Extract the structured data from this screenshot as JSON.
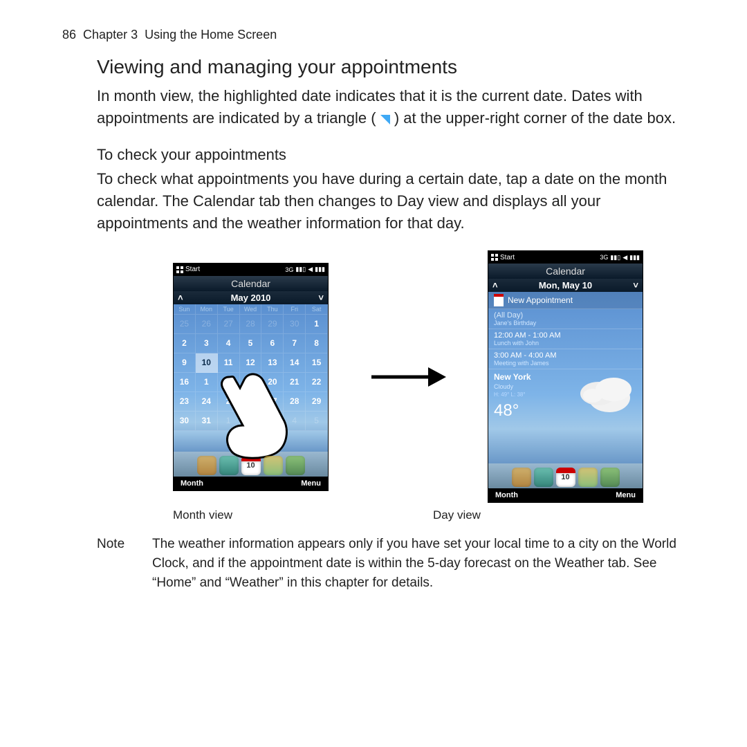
{
  "header": {
    "page_number": "86",
    "chapter": "Chapter 3",
    "chapter_title": "Using the Home Screen"
  },
  "headings": {
    "main": "Viewing and managing your appointments",
    "sub": "To check your appointments"
  },
  "paragraphs": {
    "intro_a": "In month view, the highlighted date indicates that it is the current date. Dates with appointments are indicated by a triangle (",
    "intro_b": ") at the upper-right corner of the date box.",
    "check": "To check what appointments you have during a certain date, tap a date on the month calendar. The Calendar tab then changes to Day view and displays all your appointments and the weather information for that day."
  },
  "status": {
    "start": "Start",
    "net": "3G"
  },
  "month_view": {
    "title": "Calendar",
    "date_label": "May 2010",
    "weekdays": [
      "Sun",
      "Mon",
      "Tue",
      "Wed",
      "Thu",
      "Fri",
      "Sat"
    ],
    "grid": [
      [
        {
          "n": "25",
          "dim": true
        },
        {
          "n": "26",
          "dim": true
        },
        {
          "n": "27",
          "dim": true
        },
        {
          "n": "28",
          "dim": true
        },
        {
          "n": "29",
          "dim": true
        },
        {
          "n": "30",
          "dim": true
        },
        {
          "n": "1"
        }
      ],
      [
        {
          "n": "2"
        },
        {
          "n": "3"
        },
        {
          "n": "4"
        },
        {
          "n": "5"
        },
        {
          "n": "6"
        },
        {
          "n": "7"
        },
        {
          "n": "8"
        }
      ],
      [
        {
          "n": "9"
        },
        {
          "n": "10",
          "today": true
        },
        {
          "n": "11"
        },
        {
          "n": "12"
        },
        {
          "n": "13"
        },
        {
          "n": "14"
        },
        {
          "n": "15"
        }
      ],
      [
        {
          "n": "16"
        },
        {
          "n": "1"
        },
        {
          "n": ""
        },
        {
          "n": "9"
        },
        {
          "n": "20"
        },
        {
          "n": "21"
        },
        {
          "n": "22"
        }
      ],
      [
        {
          "n": "23"
        },
        {
          "n": "24"
        },
        {
          "n": "2"
        },
        {
          "n": ""
        },
        {
          "n": "27"
        },
        {
          "n": "28"
        },
        {
          "n": "29"
        }
      ],
      [
        {
          "n": "30"
        },
        {
          "n": "31"
        },
        {
          "n": "1",
          "dim": true
        },
        {
          "n": "2",
          "dim": true
        },
        {
          "n": "3",
          "dim": true
        },
        {
          "n": "4",
          "dim": true
        },
        {
          "n": "5",
          "dim": true
        }
      ]
    ],
    "dock_date": "10",
    "soft_left": "Month",
    "soft_right": "Menu"
  },
  "day_view": {
    "title": "Calendar",
    "date_label": "Mon, May 10",
    "new_appt": "New Appointment",
    "items": [
      {
        "time": "(All Day)",
        "title": "Jane's Birthday",
        "allday": true
      },
      {
        "time": "12:00 AM - 1:00 AM",
        "title": "Lunch with John"
      },
      {
        "time": "3:00 AM - 4:00 AM",
        "title": "Meeting with James"
      }
    ],
    "weather": {
      "city": "New York",
      "cond": "Cloudy",
      "hilo": "H: 49°  L: 38°",
      "temp": "48°"
    },
    "dock_date": "10",
    "soft_left": "Month",
    "soft_right": "Menu"
  },
  "captions": {
    "left": "Month view",
    "right": "Day view"
  },
  "note": {
    "label": "Note",
    "text": "The weather information appears only if you have set your local time to a city on the World Clock, and if the appointment date is within the 5-day forecast on the Weather tab. See “Home” and “Weather” in this chapter for details."
  }
}
